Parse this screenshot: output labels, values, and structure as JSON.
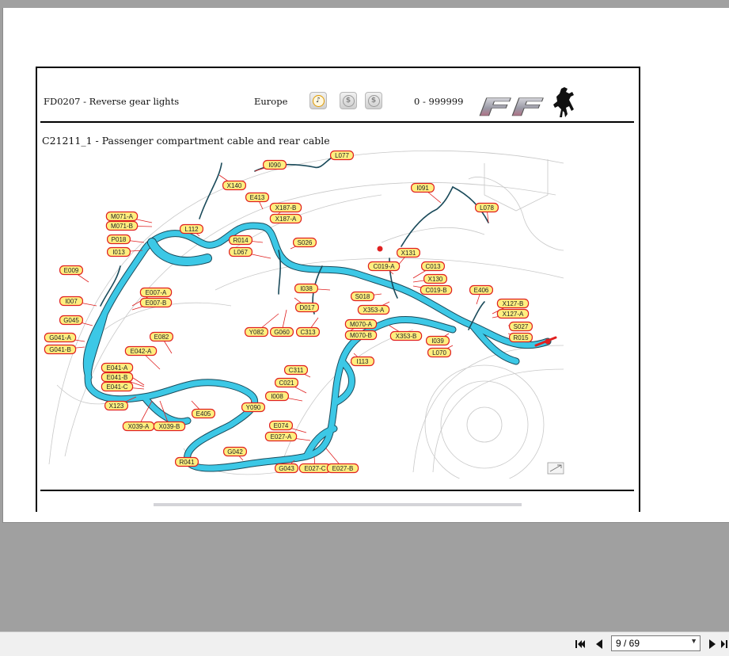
{
  "document": {
    "code": "FD0207 - Reverse gear lights",
    "market": "Europe",
    "range": "0 - 999999",
    "subtitle": "C21211_1 - Passenger compartment cable and rear cable",
    "logo_text": "FF"
  },
  "market_icons": [
    {
      "name": "market-icon-1",
      "glyph": "♪",
      "active": true
    },
    {
      "name": "market-icon-2",
      "glyph": "$",
      "active": false
    },
    {
      "name": "market-icon-3",
      "glyph": "$",
      "active": false
    }
  ],
  "connectors": [
    "L077",
    "I090",
    "X140",
    "E413",
    "I091",
    "L078",
    "M071-A",
    "M071-B",
    "X187-B",
    "X187-A",
    "L112",
    "P018",
    "R014",
    "S026",
    "I013",
    "L067",
    "X131",
    "E009",
    "C019-A",
    "C013",
    "X130",
    "C019-B",
    "I038",
    "E007-A",
    "E007-B",
    "S018",
    "E406",
    "I007",
    "D017",
    "X353-A",
    "X127-B",
    "X127-A",
    "G045",
    "M070-A",
    "S027",
    "Y082",
    "G060",
    "C313",
    "M070-B",
    "X353-B",
    "R015",
    "E082",
    "G041-A",
    "G041-B",
    "I039",
    "E042-A",
    "L070",
    "I113",
    "E041-A",
    "E041-B",
    "C311",
    "E041-C",
    "C021",
    "X123",
    "I008",
    "X039-A",
    "X039-B",
    "E405",
    "Y090",
    "E074",
    "E027-A",
    "G042",
    "R041",
    "G043",
    "E027-C",
    "E027-B"
  ],
  "navigation": {
    "page_indicator": "9 / 69"
  },
  "colors": {
    "cable": "#3cc8e6",
    "cable_outline": "#1a4a5a",
    "label_fill": "#ffef80",
    "label_border": "#e02020"
  }
}
